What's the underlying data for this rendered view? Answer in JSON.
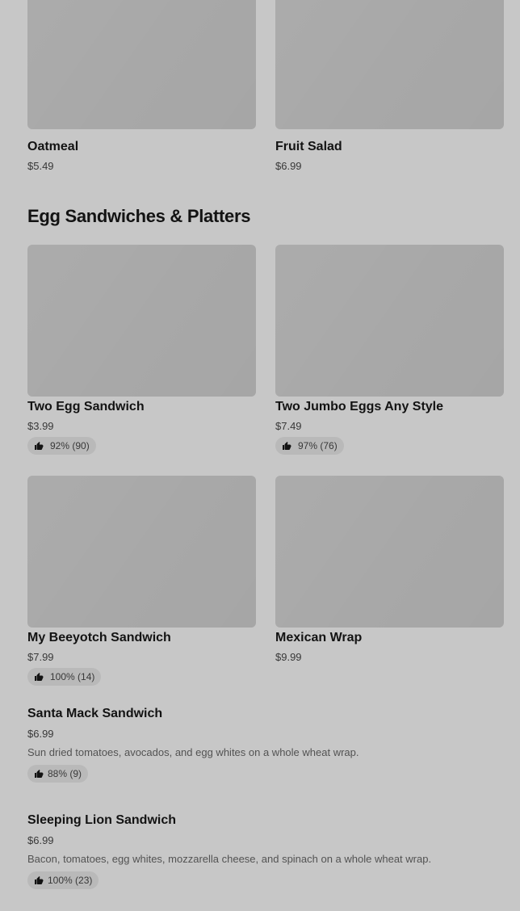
{
  "top_row": [
    {
      "name": "Oatmeal",
      "price": "$5.49"
    },
    {
      "name": "Fruit Salad",
      "price": "$6.99"
    }
  ],
  "section": {
    "title": "Egg Sandwiches & Platters"
  },
  "grid": [
    {
      "name": "Two Egg Sandwich",
      "price": "$3.99",
      "rating": "92% (90)"
    },
    {
      "name": "Two Jumbo Eggs Any Style",
      "price": "$7.49",
      "rating": "97% (76)"
    },
    {
      "name": "My Beeyotch Sandwich",
      "price": "$7.99",
      "rating": "100% (14)"
    },
    {
      "name": "Mexican Wrap",
      "price": "$9.99"
    }
  ],
  "list": [
    {
      "name": "Santa Mack Sandwich",
      "price": "$6.99",
      "description": "Sun dried tomatoes, avocados, and egg whites on a whole wheat wrap.",
      "rating": "88% (9)"
    },
    {
      "name": "Sleeping Lion Sandwich",
      "price": "$6.99",
      "description": "Bacon, tomatoes, egg whites, mozzarella cheese, and spinach on a whole wheat wrap.",
      "rating": "100% (23)"
    }
  ],
  "icons": {
    "rating_icon": "thumbs-up-icon"
  },
  "colors": {
    "badge": "#1f8a3a",
    "rating_bg": "#eeeeee"
  }
}
